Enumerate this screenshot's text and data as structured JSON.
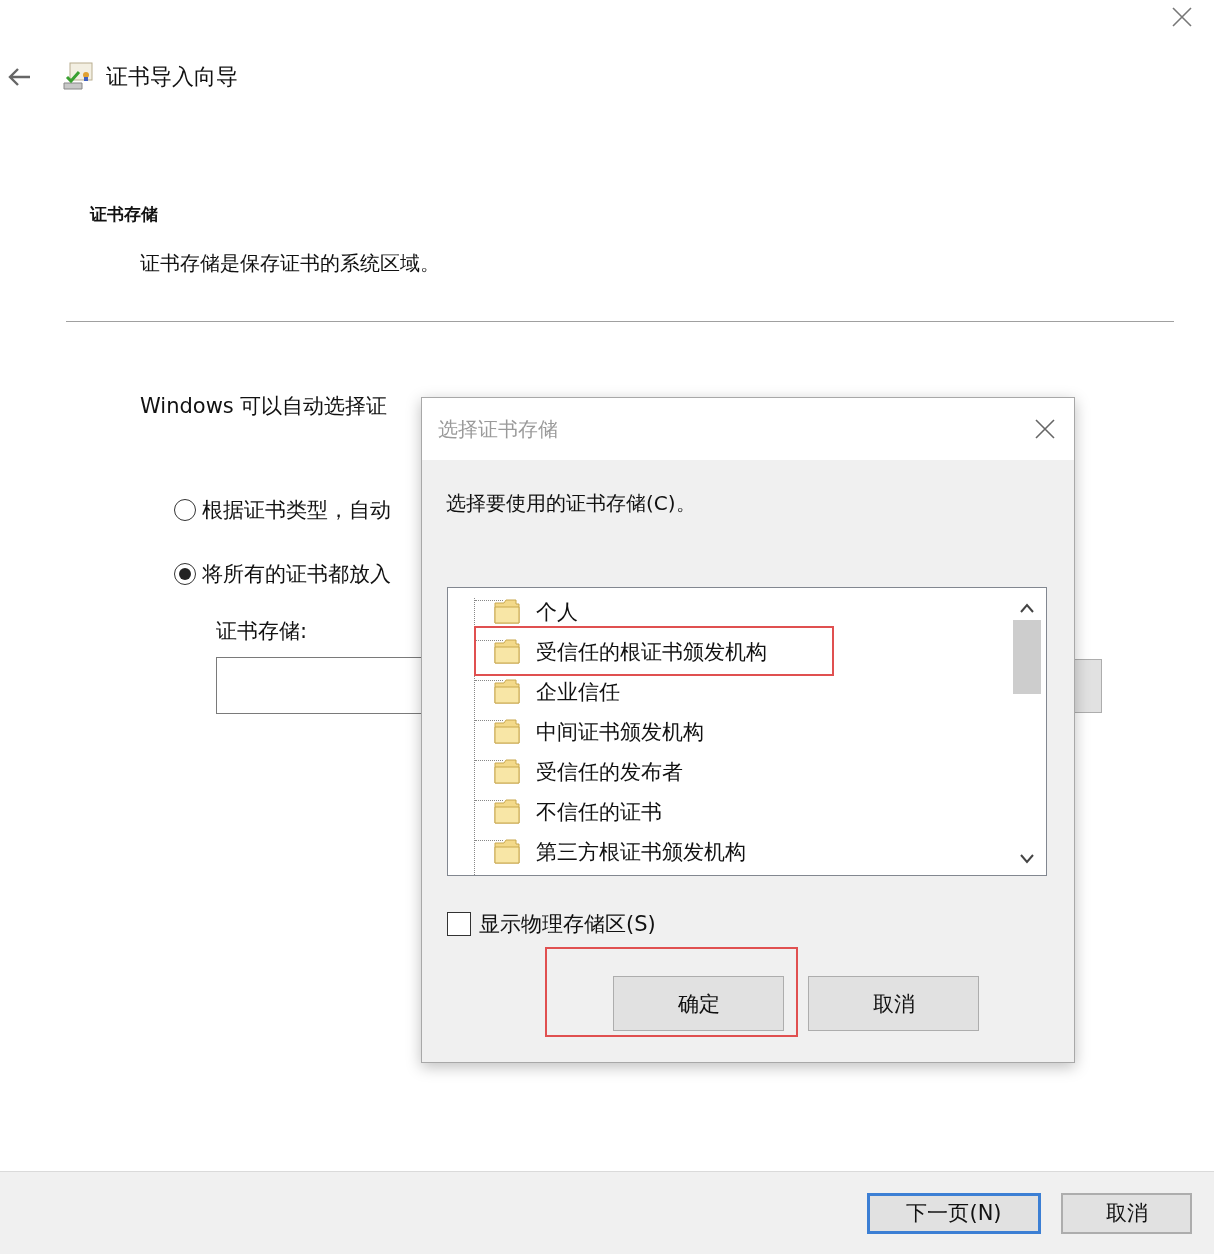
{
  "window": {
    "title": "证书导入向导"
  },
  "section": {
    "title": "证书存储",
    "description": "证书存储是保存证书的系统区域。"
  },
  "intro": "Windows 可以自动选择证",
  "options": [
    {
      "label": "根据证书类型，自动",
      "selected": false
    },
    {
      "label": "将所有的证书都放入",
      "selected": true
    }
  ],
  "store_field": {
    "label": "证书存储:"
  },
  "footer_buttons": [
    {
      "label": "下一页(N)",
      "default": true
    },
    {
      "label": "取消",
      "default": false
    }
  ],
  "dialog": {
    "title": "选择证书存储",
    "prompt": "选择要使用的证书存储(C)。",
    "stores": [
      {
        "label": "个人",
        "highlighted": false
      },
      {
        "label": "受信任的根证书颁发机构",
        "highlighted": true
      },
      {
        "label": "企业信任",
        "highlighted": false
      },
      {
        "label": "中间证书颁发机构",
        "highlighted": false
      },
      {
        "label": "受信任的发布者",
        "highlighted": false
      },
      {
        "label": "不信任的证书",
        "highlighted": false
      },
      {
        "label": "第三方根证书颁发机构",
        "highlighted": false
      }
    ],
    "show_physical": {
      "label": "显示物理存储区(S)",
      "checked": false
    },
    "buttons": [
      {
        "label": "确定",
        "highlighted": true
      },
      {
        "label": "取消",
        "highlighted": false
      }
    ]
  }
}
